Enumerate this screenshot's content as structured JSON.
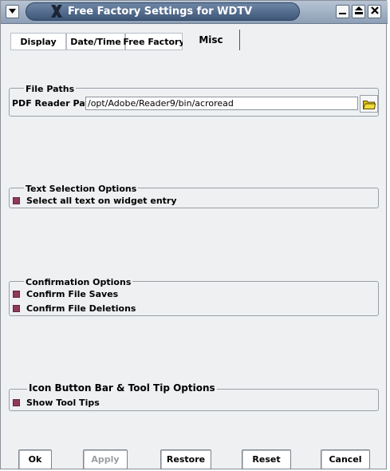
{
  "window": {
    "title": "Free Factory Settings for WDTV",
    "buttons": {
      "menu": "menu-arrow",
      "minimize": "minimize",
      "maximize": "maximize",
      "close": "close"
    }
  },
  "tabs": [
    {
      "label": "Display",
      "active": false
    },
    {
      "label": "Date/Time",
      "active": false
    },
    {
      "label": "Free Factory",
      "active": false
    },
    {
      "label": "Misc",
      "active": true
    }
  ],
  "file_paths": {
    "legend": "File Paths",
    "pdf_label": "PDF Reader Path",
    "pdf_value": "/opt/Adobe/Reader9/bin/acroread",
    "browse_icon": "folder-icon"
  },
  "text_selection": {
    "legend": "Text Selection Options",
    "select_all": {
      "label": "Select all text on widget entry",
      "checked": true
    }
  },
  "confirmation": {
    "legend": "Confirmation Options",
    "confirm_saves": {
      "label": "Confirm File Saves",
      "checked": true
    },
    "confirm_deletions": {
      "label": "Confirm File Deletions",
      "checked": true
    }
  },
  "icon_bar": {
    "legend": "Icon Button Bar & Tool Tip Options",
    "show_tooltips": {
      "label": "Show Tool Tips",
      "checked": true
    }
  },
  "footer": {
    "ok": "Ok",
    "apply": "Apply",
    "restore": "Restore",
    "reset": "Reset",
    "cancel": "Cancel"
  },
  "colors": {
    "title_pill": "#4f6889",
    "checkbox": "#8e3a5a",
    "dialog_bg": "#eef0f2"
  }
}
